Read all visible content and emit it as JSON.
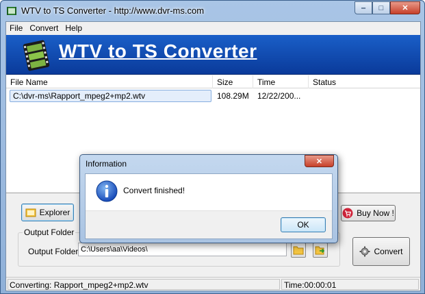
{
  "window": {
    "title": "WTV to TS Converter - http://www.dvr-ms.com",
    "minimize_glyph": "‒",
    "maximize_glyph": "□",
    "close_glyph": "✕"
  },
  "menu": {
    "items": [
      {
        "label": "File"
      },
      {
        "label": "Convert"
      },
      {
        "label": "Help"
      }
    ]
  },
  "banner": {
    "title": "WTV to TS Converter",
    "logo_icon": "film-reel-icon"
  },
  "file_list": {
    "columns": [
      {
        "label": "File Name"
      },
      {
        "label": "Size"
      },
      {
        "label": "Time"
      },
      {
        "label": "Status"
      }
    ],
    "rows": [
      {
        "file_name": "C:\\dvr-ms\\Rapport_mpeg2+mp2.wtv",
        "size": "108.29M",
        "time": "12/22/200...",
        "status": ""
      }
    ]
  },
  "buttons": {
    "explorer": "Explorer",
    "buy_now": "Buy Now !",
    "convert": "Convert"
  },
  "output": {
    "group_label": "Output Folder",
    "field_label": "Output Folder",
    "value": "C:\\Users\\aa\\Videos\\"
  },
  "status_bar": {
    "left": "Converting: Rapport_mpeg2+mp2.wtv",
    "right": "Time:00:00:01"
  },
  "dialog": {
    "title": "Information",
    "message": "Convert finished!",
    "ok_label": "OK",
    "close_glyph": "✕",
    "icon": "info-icon"
  },
  "colors": {
    "banner": "#1a5fc8",
    "title_accent": "#ffffff",
    "close_button": "#c7402a"
  }
}
